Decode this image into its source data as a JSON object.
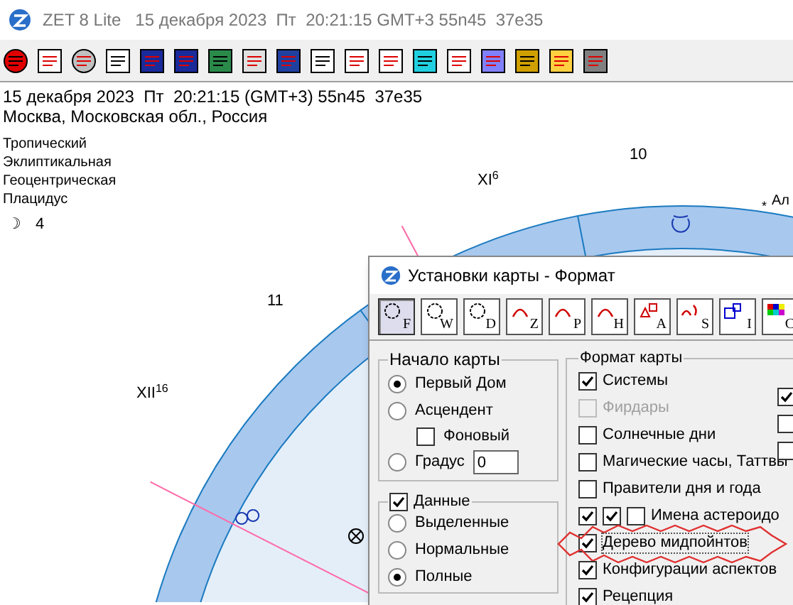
{
  "window": {
    "title": "ZET 8 Lite   15 декабря 2023  Пт  20:21:15 GMT+3 55n45  37e35"
  },
  "header": {
    "datetime": "15 декабря 2023  Пт  20:21:15 (GMT+3) 55n45  37e35",
    "place": "Москва, Московская обл., Россия"
  },
  "chart_info": [
    "Тропический",
    "Эклиптикальная",
    "Геоцентрическая",
    "Плацидус"
  ],
  "moon_symbol": "☽",
  "moon_day": "4",
  "star_symbol": "*",
  "house_labels": [
    {
      "text": "10"
    },
    {
      "text": "XI",
      "sup": "6"
    },
    {
      "text": "11"
    },
    {
      "text": "XII",
      "sup": "16"
    }
  ],
  "star_label": "Ал",
  "dialog": {
    "title": "Установки карты - Формат",
    "tabs": [
      {
        "letter": "F",
        "selected": true
      },
      {
        "letter": "W",
        "selected": false
      },
      {
        "letter": "D",
        "selected": false
      },
      {
        "letter": "Z",
        "selected": false
      },
      {
        "letter": "P",
        "selected": false
      },
      {
        "letter": "H",
        "selected": false
      },
      {
        "letter": "A",
        "selected": false
      },
      {
        "letter": "S",
        "selected": false
      },
      {
        "letter": "I",
        "selected": false
      },
      {
        "letter": "C",
        "selected": false
      }
    ],
    "start_group": {
      "title": "Начало карты",
      "options": [
        {
          "label": "Первый Дом",
          "selected": true
        },
        {
          "label": "Асцендент",
          "selected": false
        },
        {
          "label": "Градус",
          "selected": false
        }
      ],
      "background": {
        "label": "Фоновый",
        "checked": false
      },
      "degree_value": "0"
    },
    "data_group": {
      "label": "Данные",
      "checked": true,
      "options": [
        {
          "label": "Выделенные",
          "selected": false
        },
        {
          "label": "Нормальные",
          "selected": false
        },
        {
          "label": "Полные",
          "selected": true
        }
      ]
    },
    "format_group": {
      "title": "Формат карты",
      "items": [
        {
          "label": "Системы",
          "checked": true,
          "disabled": false,
          "highlighted": false
        },
        {
          "label": "Фирдары",
          "checked": false,
          "disabled": true,
          "highlighted": false
        },
        {
          "label": "Солнечные дни",
          "checked": false,
          "disabled": false,
          "highlighted": false
        },
        {
          "label": "Магические часы, Таттвы",
          "checked": false,
          "disabled": false,
          "highlighted": false
        },
        {
          "label": "Правители дня и года",
          "checked": false,
          "disabled": false,
          "highlighted": false
        },
        {
          "label": "Имена астероидо",
          "checked": true,
          "disabled": false,
          "highlighted": false,
          "extra_checks": [
            true,
            false
          ]
        },
        {
          "label": "Дерево мидпойнтов",
          "checked": true,
          "disabled": false,
          "highlighted": true
        },
        {
          "label": "Конфигурации аспектов",
          "checked": true,
          "disabled": false,
          "highlighted": false
        },
        {
          "label": "Рецепция",
          "checked": true,
          "disabled": false,
          "highlighted": false
        }
      ],
      "right_checks": [
        true,
        false,
        false
      ]
    }
  }
}
